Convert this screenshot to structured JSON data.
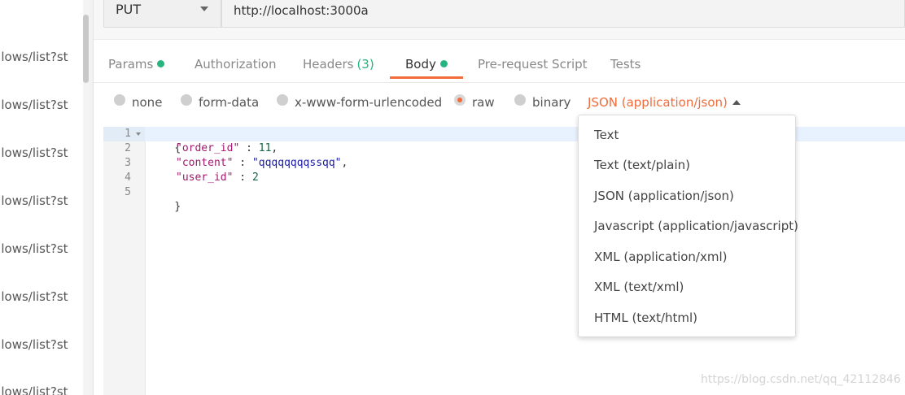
{
  "sidebar": {
    "items": [
      "ollows/list?st",
      "ollows/list?st",
      "ollows/list?st",
      "ollows/list?st",
      "ollows/list?st",
      "ollows/list?st",
      "ollows/list?st",
      "ollows/list?st"
    ]
  },
  "request": {
    "method": "PUT",
    "url": "http://localhost:3000a"
  },
  "tabs": {
    "params": "Params",
    "authorization": "Authorization",
    "headers": "Headers",
    "headers_count": "(3)",
    "body": "Body",
    "prerequest": "Pre-request Script",
    "tests": "Tests"
  },
  "body_modes": {
    "none": "none",
    "form_data": "form-data",
    "urlencoded": "x-www-form-urlencoded",
    "raw": "raw",
    "binary": "binary",
    "selected_content_type": "JSON (application/json)"
  },
  "editor": {
    "line_numbers": [
      "1",
      "2",
      "3",
      "4",
      "5"
    ],
    "lines": {
      "l1": "{",
      "l2_key": "\"order_id\"",
      "l2_sep": " : ",
      "l2_val": "11",
      "l2_end": ",",
      "l3_key": "\"content\"",
      "l3_sep": " : ",
      "l3_val": "\"qqqqqqqqssqq\"",
      "l3_end": ",",
      "l4_key": "\"user_id\"",
      "l4_sep": " : ",
      "l4_val": "2",
      "l5": "}"
    }
  },
  "dropdown": {
    "options": [
      "Text",
      "Text (text/plain)",
      "JSON (application/json)",
      "Javascript (application/javascript)",
      "XML (application/xml)",
      "XML (text/xml)",
      "HTML (text/html)"
    ]
  },
  "watermark": "https://blog.csdn.net/qq_42112846",
  "colors": {
    "accent": "#f26b3a",
    "success": "#26b47f"
  }
}
